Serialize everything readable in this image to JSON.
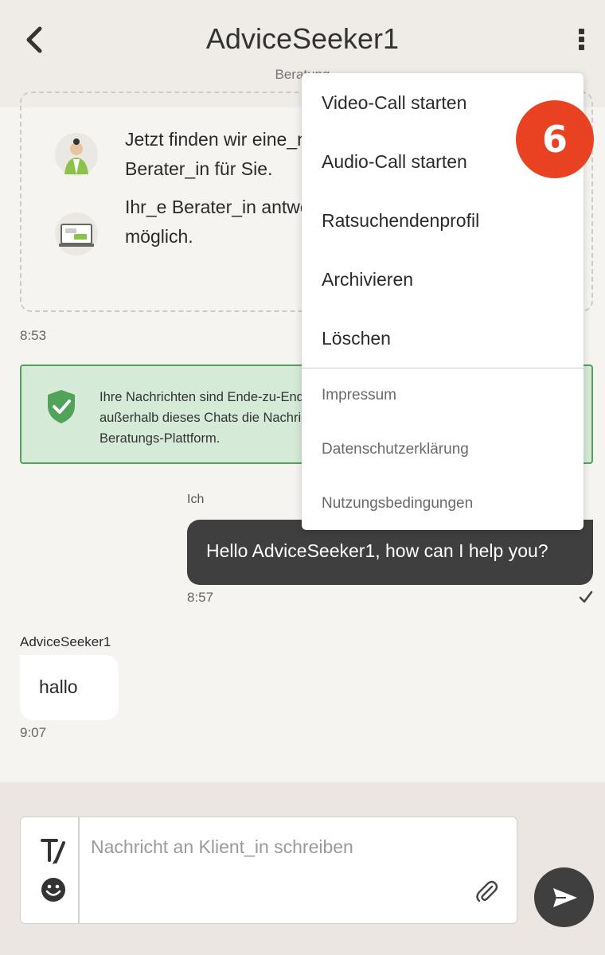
{
  "header": {
    "title": "AdviceSeeker1",
    "subtitle": "Beratung"
  },
  "intro": {
    "line1": "Jetzt finden wir eine_n\nBerater_in für Sie.",
    "line2": "Ihr_e Berater_in antwortet\nmöglich.",
    "time": "8:53"
  },
  "security_notice": {
    "text": "Ihre Nachrichten sind Ende-zu-Ende verschlüsselt. Das bedeutet, dass niemand außerhalb dieses Chats die Nachrichten lesen kann – nicht einmal die Online-Beratungs-Plattform."
  },
  "messages": [
    {
      "sender": "Ich",
      "text": "Hello AdviceSeeker1, how can I help you?",
      "time": "8:57"
    },
    {
      "sender": "AdviceSeeker1",
      "text": "hallo",
      "time": "9:07"
    }
  ],
  "composer": {
    "placeholder": "Nachricht an Klient_in schreiben"
  },
  "menu": {
    "items": [
      "Video-Call starten",
      "Audio-Call starten",
      "Ratsuchendenprofil",
      "Archivieren",
      "Löschen"
    ],
    "legal": [
      "Impressum",
      "Datenschutzerklärung",
      "Nutzungsbedingungen"
    ]
  },
  "step_badge": "6",
  "colors": {
    "accent_green": "#52a35a",
    "badge_red": "#e84223",
    "dark_bubble": "#3f3f3f"
  }
}
